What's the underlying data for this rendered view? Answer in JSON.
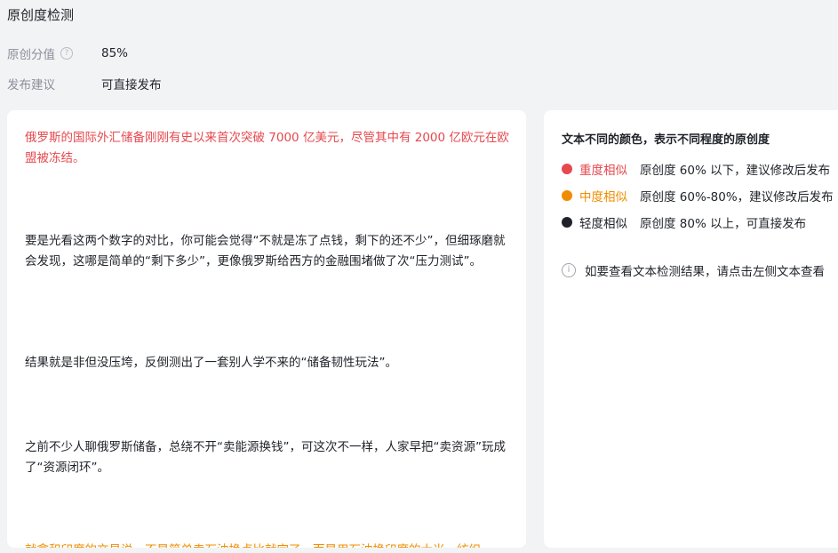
{
  "header": {
    "title": "原创度检测",
    "score_label": "原创分值",
    "score_value": "85%",
    "advice_label": "发布建议",
    "advice_value": "可直接发布"
  },
  "article": {
    "paragraphs": [
      {
        "text": "俄罗斯的国际外汇储备刚刚有史以来首次突破 7000 亿美元，尽管其中有 2000 亿欧元在欧盟被冻结。",
        "level": "heavy"
      },
      {
        "text": "要是光看这两个数字的对比，你可能会觉得“不就是冻了点钱，剩下的还不少”，但细琢磨就会发现，这哪是简单的“剩下多少”，更像俄罗斯给西方的金融围堵做了次“压力测试”。",
        "level": "light"
      },
      {
        "text": "结果就是非但没压垮，反倒测出了一套别人学不来的“储备韧性玩法”。",
        "level": "light"
      },
      {
        "text": "之前不少人聊俄罗斯储备，总绕不开“卖能源换钱”，可这次不一样，人家早把“卖资源”玩成了“资源闭环”。",
        "level": "light"
      },
      {
        "text": "就拿和印度的交易说，不是简单卖石油换卢比就完了，而是用石油换印度的大米、纺织",
        "level": "medium"
      }
    ]
  },
  "legend": {
    "title": "文本不同的颜色，表示不同程度的原创度",
    "items": [
      {
        "name": "重度相似",
        "desc": "原创度 60% 以下，建议修改后发布",
        "color": "#e5484d"
      },
      {
        "name": "中度相似",
        "desc": "原创度 60%-80%，建议修改后发布",
        "color": "#f08c00"
      },
      {
        "name": "轻度相似",
        "desc": "原创度 80% 以上，可直接发布",
        "color": "#1f2329"
      }
    ],
    "info_text": "如要查看文本检测结果，请点击左侧文本查看"
  }
}
